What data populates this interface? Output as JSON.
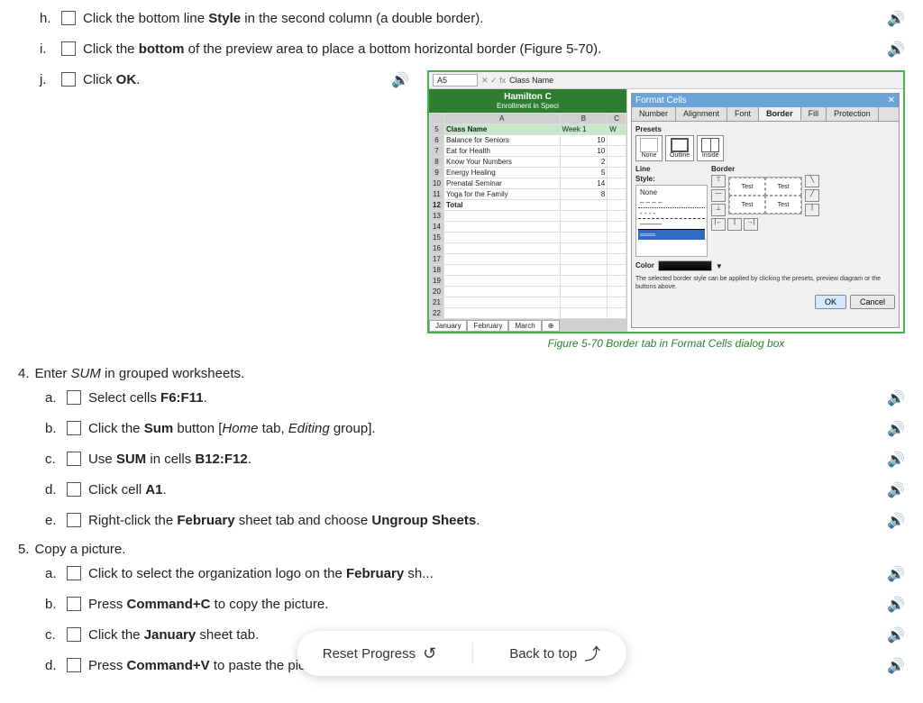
{
  "items_top": [
    {
      "letter": "h.",
      "text_before": "Click the bottom line ",
      "bold1": "Style",
      "text_after": " in the second column (a double border)."
    },
    {
      "letter": "i.",
      "text_before": "Click the ",
      "bold1": "bottom",
      "text_after": " of the preview area to place a bottom horizontal border (Figure 5-70)."
    },
    {
      "letter": "j.",
      "text_before": "Click ",
      "bold1": "OK",
      "text_after": "."
    }
  ],
  "section4": {
    "heading_before": "Enter ",
    "heading_italic": "SUM",
    "heading_after": " in grouped worksheets.",
    "number": "4.",
    "items": [
      {
        "letter": "a.",
        "text_before": "Select cells ",
        "bold1": "F6:F11",
        "text_after": "."
      },
      {
        "letter": "b.",
        "text_before": "Click the ",
        "bold1": "Sum",
        "text_after": " button [",
        "italic1": "Home",
        "text_after2": " tab, ",
        "italic2": "Editing",
        "text_after3": " group]."
      },
      {
        "letter": "c.",
        "text_before": "Use ",
        "bold1": "SUM",
        "text_after": " in cells ",
        "bold2": "B12:F12",
        "text_after2": "."
      },
      {
        "letter": "d.",
        "text_before": "Click cell ",
        "bold1": "A1",
        "text_after": "."
      },
      {
        "letter": "e.",
        "text_before": "Right-click the ",
        "bold1": "February",
        "text_after": " sheet tab and choose ",
        "bold2": "Ungroup Sheets",
        "text_after2": "."
      }
    ]
  },
  "section5": {
    "number": "5.",
    "heading": "Copy a picture.",
    "items": [
      {
        "letter": "a.",
        "text_before": "Click to select the organization logo on the ",
        "bold1": "February",
        "text_after": " sh..."
      },
      {
        "letter": "b.",
        "text_before": "Press ",
        "bold1": "Command+C",
        "text_after": " to copy the picture."
      },
      {
        "letter": "c.",
        "text_before": "Click the ",
        "bold1": "January",
        "text_after": " sheet tab."
      },
      {
        "letter": "d.",
        "text_before": "Press ",
        "bold1": "Command+V",
        "text_after": " to paste the picture."
      }
    ]
  },
  "figure": {
    "caption": "Figure 5-70 Border tab in Format Cells dialog box",
    "name_box": "A5",
    "formula_bar": "Class Name",
    "sheet_header": "Hamilton C",
    "sheet_subtitle": "Enrollment in Speci",
    "table_rows": [
      [
        "",
        "A",
        "B",
        "C"
      ],
      [
        "5",
        "Class Name",
        "Week 1",
        "W"
      ],
      [
        "6",
        "Balance for Seniors",
        "10",
        ""
      ],
      [
        "7",
        "Eat for Health",
        "10",
        ""
      ],
      [
        "8",
        "Know Your Numbers",
        "2",
        ""
      ],
      [
        "9",
        "Energy Healing",
        "5",
        ""
      ],
      [
        "10",
        "Prenatal Seminar",
        "14",
        ""
      ],
      [
        "11",
        "Yoga for the Family",
        "8",
        ""
      ],
      [
        "12",
        "Total",
        "",
        ""
      ]
    ],
    "sheet_tabs": [
      "January",
      "February",
      "March"
    ],
    "dialog_title": "Format Cells",
    "dialog_tabs": [
      "Number",
      "Alignment",
      "Font",
      "Border",
      "Fill",
      "Protection"
    ],
    "active_tab": "Border",
    "presets_label": "Presets",
    "line_label": "Line",
    "style_label": "Style:",
    "border_label": "Border",
    "color_label": "Color",
    "info_text": "The selected border style can be applied by clicking the presets, preview diagram or the buttons above.",
    "ok_label": "OK",
    "cancel_label": "Cancel",
    "none_label": "None",
    "outline_label": "Outline",
    "inside_label": "Inside",
    "test_label": "Test"
  },
  "toolbar": {
    "reset_label": "Reset Progress",
    "back_to_top_label": "Back to top"
  }
}
